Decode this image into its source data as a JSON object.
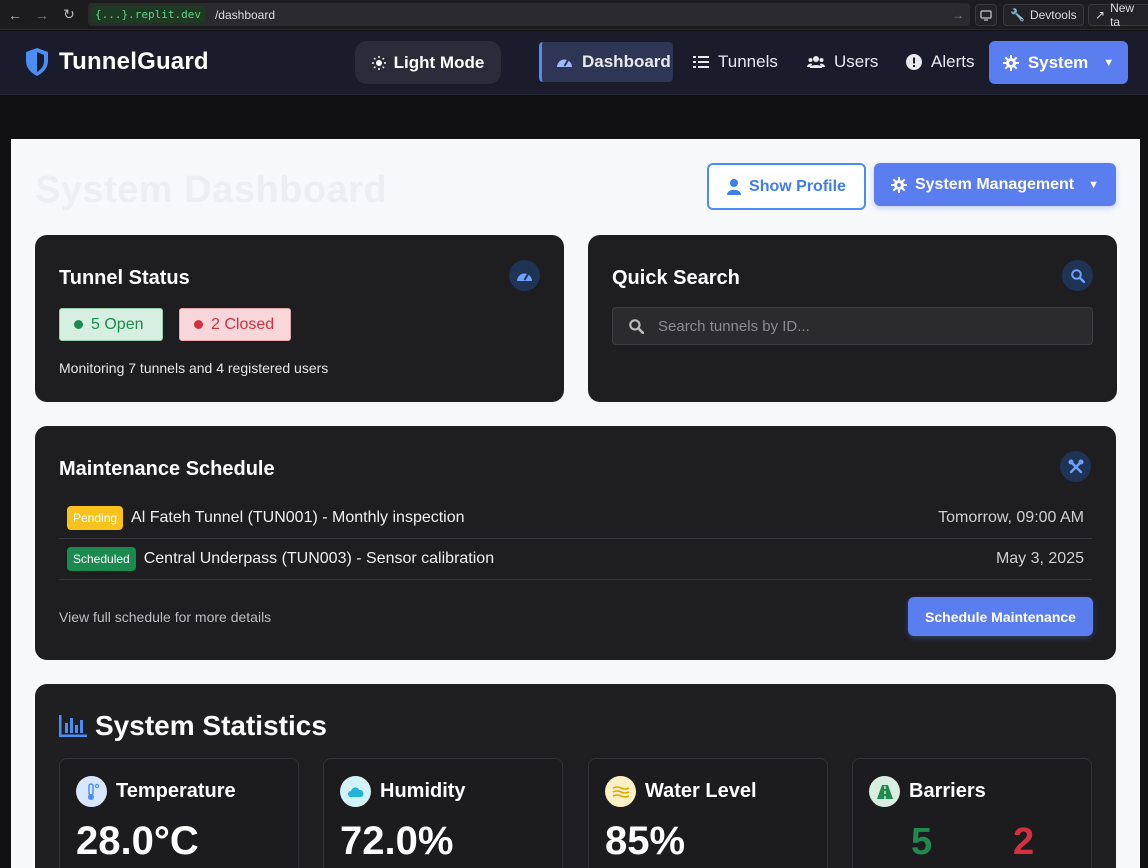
{
  "browser": {
    "url_host": "{...}.replit.dev",
    "url_path": "/dashboard",
    "devtools_label": "Devtools",
    "new_tab_label": "New ta"
  },
  "header": {
    "brand": "TunnelGuard",
    "theme_toggle_label": "Light Mode",
    "nav": {
      "dashboard": "Dashboard",
      "tunnels": "Tunnels",
      "users": "Users",
      "alerts": "Alerts",
      "system": "System"
    }
  },
  "page": {
    "title": "System Dashboard",
    "show_profile_label": "Show Profile",
    "system_management_label": "System Management"
  },
  "tunnel_status": {
    "title": "Tunnel Status",
    "open_label": "5 Open",
    "closed_label": "2 Closed",
    "summary": "Monitoring 7 tunnels and 4 registered users"
  },
  "quick_search": {
    "title": "Quick Search",
    "placeholder": "Search tunnels by ID..."
  },
  "maintenance": {
    "title": "Maintenance Schedule",
    "items": [
      {
        "status": "Pending",
        "description": "Al Fateh Tunnel (TUN001) - Monthly inspection",
        "when": "Tomorrow, 09:00 AM"
      },
      {
        "status": "Scheduled",
        "description": "Central Underpass (TUN003) - Sensor calibration",
        "when": "May 3, 2025"
      }
    ],
    "footer_text": "View full schedule for more details",
    "schedule_button_label": "Schedule Maintenance"
  },
  "stats": {
    "title": "System Statistics",
    "temperature": {
      "label": "Temperature",
      "value": "28.0°C"
    },
    "humidity": {
      "label": "Humidity",
      "value": "72.0%"
    },
    "water_level": {
      "label": "Water Level",
      "value": "85%"
    },
    "barriers": {
      "label": "Barriers",
      "open": "5",
      "closed": "2"
    }
  },
  "colors": {
    "accent": "#5a7ef0",
    "open_green": "#1e8a4d",
    "closed_red": "#d2303f",
    "pending_yellow": "#f7c21c"
  }
}
